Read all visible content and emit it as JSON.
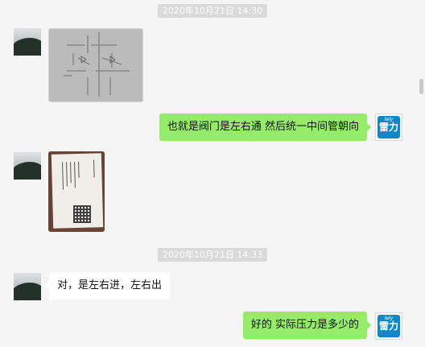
{
  "timestamps": [
    "2020年10月21日 14:30",
    "2020年10月21日 14:33"
  ],
  "messages": [
    {
      "from": "contact",
      "kind": "image",
      "content": "hand-drawn valve sketch photo"
    },
    {
      "from": "me",
      "kind": "text",
      "text": "也就是阀门是左右通 然后统一中间管朝向"
    },
    {
      "from": "contact",
      "kind": "image",
      "content": "printed card with QR code photo"
    },
    {
      "from": "contact",
      "kind": "text",
      "text": "对，是左右进，左右出"
    },
    {
      "from": "me",
      "kind": "text",
      "text": "好的 实际压力是多少的"
    }
  ],
  "brand_avatar": {
    "en": "lely",
    "zh": "雷力"
  },
  "colors": {
    "background": "#f5f5f5",
    "sent_bubble": "#95ec69",
    "received_bubble": "#ffffff",
    "timestamp_bg": "#dadada",
    "brand_blue": "#0e88c8"
  }
}
